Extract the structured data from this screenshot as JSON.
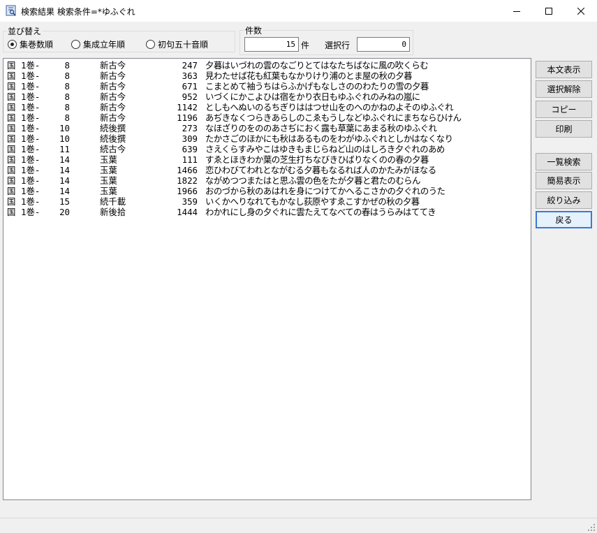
{
  "window": {
    "title": "検索結果 検索条件=*ゆふぐれ"
  },
  "sort": {
    "label": "並び替え",
    "options": [
      {
        "label": "集巻数順",
        "selected": true
      },
      {
        "label": "集成立年順",
        "selected": false
      },
      {
        "label": "初句五十音順",
        "selected": false
      }
    ]
  },
  "count": {
    "label": "件数",
    "value": "15",
    "unit": "件",
    "selected_label": "選択行",
    "selected_value": "0"
  },
  "results": [
    {
      "kuni": "国",
      "vol": "1巻-",
      "num": "8",
      "coll": "新古今",
      "no": "247",
      "poem": "夕暮はいづれの雲のなごりとてはなたちばなに風の吹くらむ"
    },
    {
      "kuni": "国",
      "vol": "1巻-",
      "num": "8",
      "coll": "新古今",
      "no": "363",
      "poem": "見わたせば花も紅葉もなかりけり浦のとま屋の秋の夕暮"
    },
    {
      "kuni": "国",
      "vol": "1巻-",
      "num": "8",
      "coll": "新古今",
      "no": "671",
      "poem": "こまとめて袖うちはらふかげもなしさののわたりの雪の夕暮"
    },
    {
      "kuni": "国",
      "vol": "1巻-",
      "num": "8",
      "coll": "新古今",
      "no": "952",
      "poem": "いづくにかこよひは宿をかり衣日もゆふぐれのみねの嵐に"
    },
    {
      "kuni": "国",
      "vol": "1巻-",
      "num": "8",
      "coll": "新古今",
      "no": "1142",
      "poem": "としもへぬいのるちぎりははつせ山をのへのかねのよそのゆふぐれ"
    },
    {
      "kuni": "国",
      "vol": "1巻-",
      "num": "8",
      "coll": "新古今",
      "no": "1196",
      "poem": "あぢきなくつらきあらしのこゑもうしなどゆふぐれにまちならひけん"
    },
    {
      "kuni": "国",
      "vol": "1巻-",
      "num": "10",
      "coll": "続後撰",
      "no": "273",
      "poem": "なほざりのをののあさぢにおく露も草葉にあまる秋のゆふぐれ"
    },
    {
      "kuni": "国",
      "vol": "1巻-",
      "num": "10",
      "coll": "続後撰",
      "no": "309",
      "poem": "たかさごのほかにも秋はあるものをわがゆふぐれとしかはなくなり"
    },
    {
      "kuni": "国",
      "vol": "1巻-",
      "num": "11",
      "coll": "続古今",
      "no": "639",
      "poem": "さえくらすみやこはゆきもまじらねど山のはしろき夕ぐれのあめ"
    },
    {
      "kuni": "国",
      "vol": "1巻-",
      "num": "14",
      "coll": "玉葉",
      "no": "111",
      "poem": "すゑとほきわか葉の芝生打ちなびきひばりなくのの春の夕暮"
    },
    {
      "kuni": "国",
      "vol": "1巻-",
      "num": "14",
      "coll": "玉葉",
      "no": "1466",
      "poem": "恋ひわびてわれとながむる夕暮もなるれば人のかたみがほなる"
    },
    {
      "kuni": "国",
      "vol": "1巻-",
      "num": "14",
      "coll": "玉葉",
      "no": "1822",
      "poem": "ながめつつまたはと思ふ雲の色をたが夕暮と君たのむらん"
    },
    {
      "kuni": "国",
      "vol": "1巻-",
      "num": "14",
      "coll": "玉葉",
      "no": "1966",
      "poem": "おのづから秋のあはれを身につけてかへるこさかの夕ぐれのうた"
    },
    {
      "kuni": "国",
      "vol": "1巻-",
      "num": "15",
      "coll": "続千載",
      "no": "359",
      "poem": "いくかへりなれてもかなし荻原やすゑこすかぜの秋の夕暮"
    },
    {
      "kuni": "国",
      "vol": "1巻-",
      "num": "20",
      "coll": "新後拾",
      "no": "1444",
      "poem": "わかれにし身の夕ぐれに雲たえてなべての春はうらみはててき"
    }
  ],
  "buttons": {
    "view_text": "本文表示",
    "deselect": "選択解除",
    "copy": "コピー",
    "print": "印刷",
    "list_search": "一覧検索",
    "simple_view": "簡易表示",
    "narrow": "絞り込み",
    "back": "戻る"
  },
  "icons": {
    "app": "book-search-icon",
    "minimize": "minimize-icon",
    "maximize": "maximize-icon",
    "close": "close-icon",
    "resize": "resize-grip-icon"
  },
  "colors": {
    "focus_border": "#3b78d8"
  }
}
